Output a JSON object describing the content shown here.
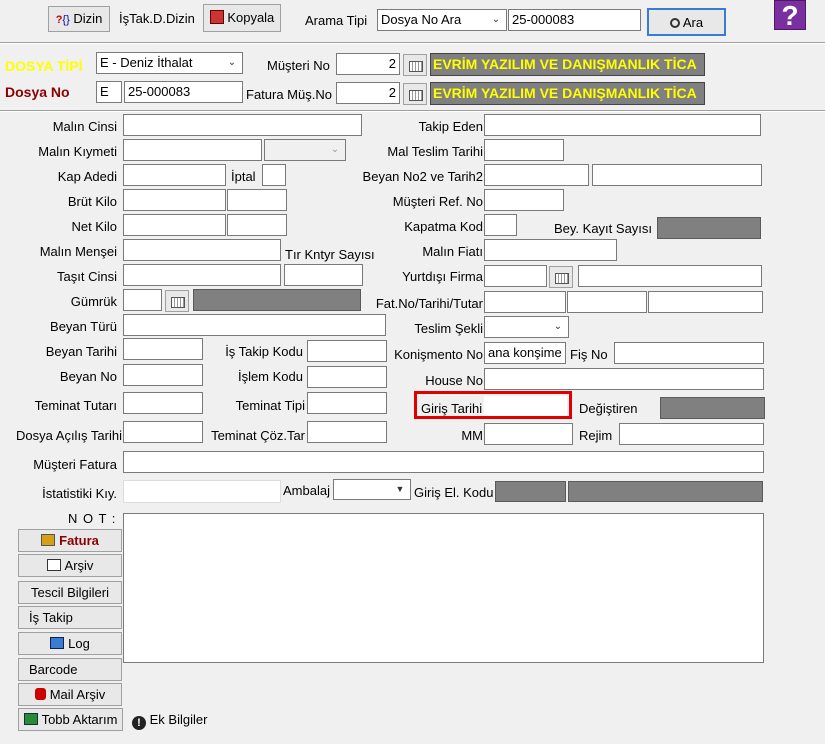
{
  "toolbar": {
    "dizin_label": "Dizin",
    "istak_label": "İşTak.D.Dizin",
    "kopyala_label": "Kopyala",
    "arama_tipi_label": "Arama Tipi",
    "arama_tipi_value": "Dosya No Ara",
    "arama_value": "25-000083",
    "ara_label": "Ara",
    "help_glyph": "?"
  },
  "header": {
    "dosya_tipi_label": "DOSYA TİPİ",
    "dosya_tipi_value": "E - Deniz İthalat",
    "musteri_no_label": "Müşteri No",
    "musteri_no_value": "2",
    "musteri_name": "EVRİM YAZILIM VE DANIŞMANLIK TİCA",
    "dosya_no_label": "Dosya No",
    "dosya_no_prefix": "E",
    "dosya_no_value": "25-000083",
    "fatura_mus_label": "Fatura Müş.No",
    "fatura_mus_value": "2",
    "fatura_mus_name": "EVRİM YAZILIM VE DANIŞMANLIK TİCA"
  },
  "form": {
    "malin_cinsi": "Malın Cinsi",
    "takip_eden": "Takip Eden",
    "malin_kiymeti": "Malın Kıymeti",
    "mal_teslim_tarihi": "Mal Teslim Tarihi",
    "kap_adedi": "Kap Adedi",
    "iptal": "İptal",
    "beyan_no2": "Beyan  No2 ve Tarih2",
    "brut_kilo": "Brüt Kilo",
    "musteri_ref": "Müşteri  Ref. No",
    "net_kilo": "Net Kilo",
    "kapatma_kod": "Kapatma Kod",
    "bey_kayit": "Bey. Kayıt Sayısı",
    "malin_mensei": "Malın Menşei",
    "tir_kntyr": "Tır Kntyr Sayısı",
    "malin_fiati": "Malın Fiatı",
    "tasit_cinsi": "Taşıt Cinsi",
    "yurtdisi_firma": "Yurtdışı Firma",
    "gumruk": "Gümrük",
    "fat_no": "Fat.No/Tarihi/Tutar",
    "beyan_turu": "Beyan Türü",
    "teslim_sekli": "Teslim Şekli",
    "beyan_tarihi": "Beyan Tarihi",
    "is_takip_kodu": "İş Takip Kodu",
    "konsimento_no": "Konişmento No",
    "konsimento_value": "ana konşime",
    "fis_no": "Fiş No",
    "beyan_no": "Beyan No",
    "islem_kodu": "İşlem Kodu",
    "house_no": "House No",
    "teminat_tutari": "Teminat Tutarı",
    "teminat_tipi": "Teminat Tipi",
    "giris_tarihi": "Giriş Tarihi",
    "degistiren": "Değiştiren",
    "dosya_acilis": "Dosya Açılış Tarihi",
    "teminat_coz": "Teminat Çöz.Tar",
    "mm": "MM",
    "rejim": "Rejim",
    "musteri_fatura": "Müşteri Fatura",
    "istatistiki": "İstatistiki Kıy.",
    "ambalaj": "Ambalaj",
    "giris_el_kodu": "Giriş El. Kodu",
    "not": "N O T :"
  },
  "side_buttons": {
    "fatura": "Fatura",
    "arsiv": "Arşiv",
    "tescil": "Tescil Bilgileri",
    "is_takip": "İş Takip",
    "log": "Log",
    "barcode": "Barcode",
    "mail_arsiv": "Mail Arşiv",
    "tobb": "Tobb Aktarım",
    "ek_bilgiler": "Ek Bilgiler"
  }
}
